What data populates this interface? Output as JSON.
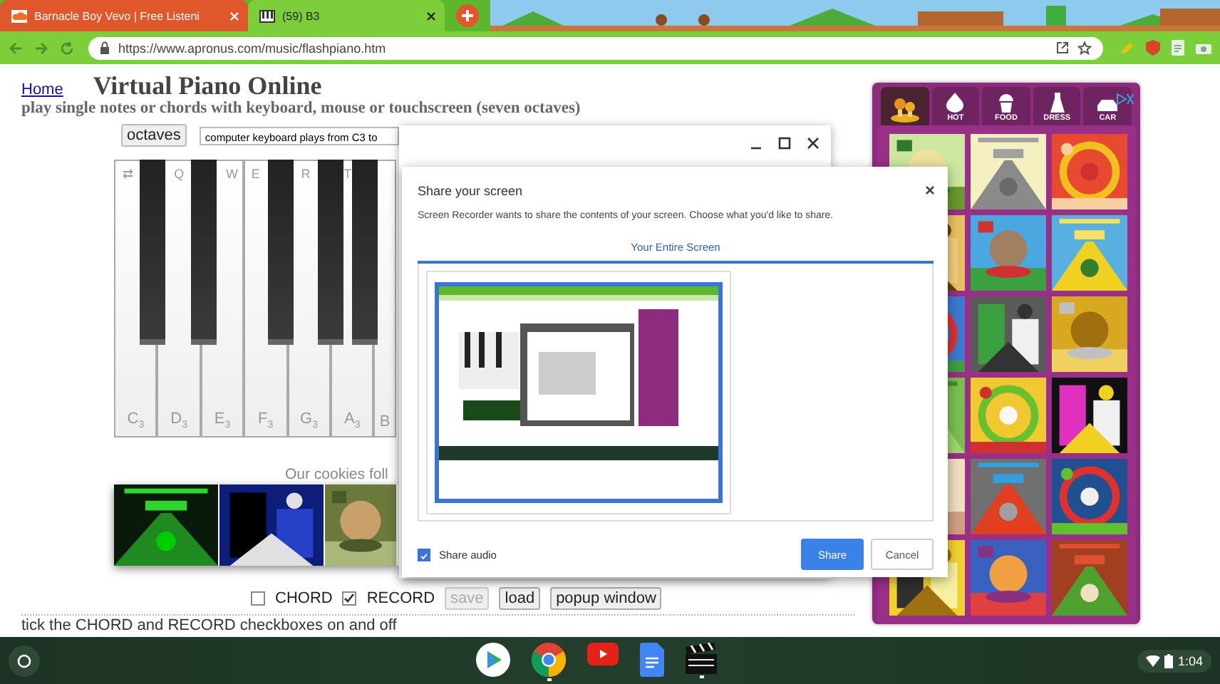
{
  "browser": {
    "tabs": [
      {
        "kind": "music",
        "title": "Barnacle Boy Vevo | Free Listeni",
        "selected": false
      },
      {
        "kind": "piano",
        "title": "(59) B3",
        "selected": true
      }
    ],
    "url": "https://www.apronus.com/music/flashpiano.htm"
  },
  "page": {
    "home_link": "Home",
    "title": "Virtual Piano Online",
    "subtitle": "play single notes or chords with keyboard, mouse or touchscreen (seven octaves)",
    "octaves_button": "octaves",
    "keyboard_select": "computer keyboard plays from C3 to",
    "keys": [
      {
        "note": "C$_{3}$",
        "shortcut": "⇄",
        "sharp": true
      },
      {
        "note": "D$_{3}$",
        "shortcut": "Q",
        "sharp": true
      },
      {
        "note": "E$_{3}$",
        "shortcut": "W",
        "sharp": false
      },
      {
        "note": "F$_{3}$",
        "shortcut": "E",
        "sharp": true
      },
      {
        "note": "G$_{3}$",
        "shortcut": "R",
        "sharp": true
      },
      {
        "note": "A$_{3}$",
        "shortcut": "T",
        "sharp": true
      },
      {
        "note": "B",
        "sharp": false
      }
    ],
    "cookies_text": "Our cookies foll",
    "options": [
      {
        "kind": "checkbox",
        "label": "CHORD",
        "checked": false
      },
      {
        "kind": "checkbox",
        "label": "RECORD",
        "checked": true
      },
      {
        "kind": "button",
        "label": "save",
        "disabled": true
      },
      {
        "kind": "button",
        "label": "load",
        "disabled": false
      },
      {
        "kind": "button",
        "label": "popup window",
        "disabled": false
      }
    ],
    "hint": "tick the CHORD and RECORD checkboxes on and off"
  },
  "ad": {
    "tabs": [
      {
        "kind": "logo",
        "selected": true
      },
      {
        "kind": "category",
        "label": "HOT",
        "selected": false
      },
      {
        "kind": "category",
        "label": "FOOD",
        "selected": false
      },
      {
        "kind": "category",
        "label": "DRESS",
        "selected": false
      },
      {
        "kind": "category",
        "label": "CAR",
        "selected": false
      }
    ]
  },
  "dialog": {
    "title": "Share your screen",
    "message": "Screen Recorder wants to share the contents of your screen. Choose what you'd like to share.",
    "tabs": [
      {
        "label": "Your Entire Screen",
        "selected": true
      }
    ],
    "sources": [
      {
        "kind": "screen",
        "selected": true
      }
    ],
    "share_audio": {
      "label": "Share audio",
      "checked": true
    },
    "buttons": [
      {
        "kind": "primary",
        "label": "Share"
      },
      {
        "kind": "secondary",
        "label": "Cancel"
      }
    ]
  },
  "taskbar": {
    "apps": [
      {
        "kind": "play",
        "running": false
      },
      {
        "kind": "browser",
        "running": true
      },
      {
        "kind": "video",
        "running": false
      },
      {
        "kind": "docs",
        "running": false
      },
      {
        "kind": "clapper",
        "running": true
      }
    ],
    "time": "1:04"
  }
}
